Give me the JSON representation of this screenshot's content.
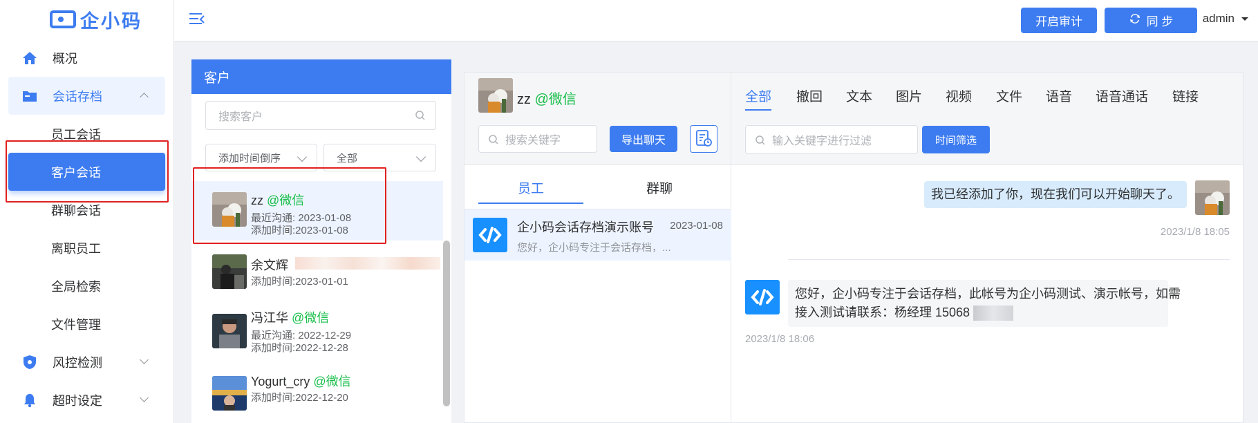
{
  "app": {
    "logo_text": "企小码"
  },
  "sidebar": {
    "items": [
      {
        "label": "概况",
        "icon": "home-icon"
      },
      {
        "label": "会话存档",
        "icon": "folder-icon"
      },
      {
        "label": "风控检测",
        "icon": "shield-icon"
      },
      {
        "label": "超时设定",
        "icon": "bell-icon"
      }
    ],
    "sub_items": [
      "员工会话",
      "客户会话",
      "群聊会话",
      "离职员工",
      "全局检索",
      "文件管理"
    ]
  },
  "header": {
    "audit_label": "开启审计",
    "sync_label": "同 步",
    "user_label": "admin"
  },
  "customers": {
    "title": "客户",
    "search_placeholder": "搜索客户",
    "sort_value": "添加时间倒序",
    "filter_value": "全部",
    "items": [
      {
        "name": "zz",
        "tag": "@微信",
        "line1": "最近沟通: 2023-01-08",
        "line2": "添加时间:2023-01-08"
      },
      {
        "name": "余文辉",
        "tag": "",
        "line1": "添加时间:2023-01-01",
        "line2": ""
      },
      {
        "name": "冯江华",
        "tag": "@微信",
        "line1": "最近沟通: 2022-12-29",
        "line2": "添加时间:2022-12-28"
      },
      {
        "name": "Yogurt_cry",
        "tag": "@微信",
        "line1": "添加时间:2022-12-20",
        "line2": ""
      }
    ]
  },
  "conversation": {
    "contact_name": "zz",
    "contact_tag": "@微信",
    "search_placeholder": "搜索关键字",
    "export_label": "导出聊天",
    "tabs": [
      "员工",
      "群聊"
    ],
    "item": {
      "title": "企小码会话存档演示账号",
      "date": "2023-01-08",
      "preview": "您好，企小码专注于会话存档，..."
    }
  },
  "messages": {
    "tabs": [
      "全部",
      "撤回",
      "文本",
      "图片",
      "视频",
      "文件",
      "语音",
      "语音通话",
      "链接"
    ],
    "filter_placeholder": "输入关键字进行过滤",
    "time_filter_label": "时间筛选",
    "msg1": {
      "text": "我已经添加了你，现在我们可以开始聊天了。",
      "time": "2023/1/8 18:05"
    },
    "msg2": {
      "text1": "您好，企小码专注于会话存档，此帐号为企小码测试、演示帐号，如需",
      "text2": "接入测试请联系：杨经理 15068",
      "time": "2023/1/8 18:06"
    }
  },
  "colors": {
    "primary": "#3d7cf0",
    "wechat_green": "#19be4b",
    "annotation_red": "#e02020"
  }
}
